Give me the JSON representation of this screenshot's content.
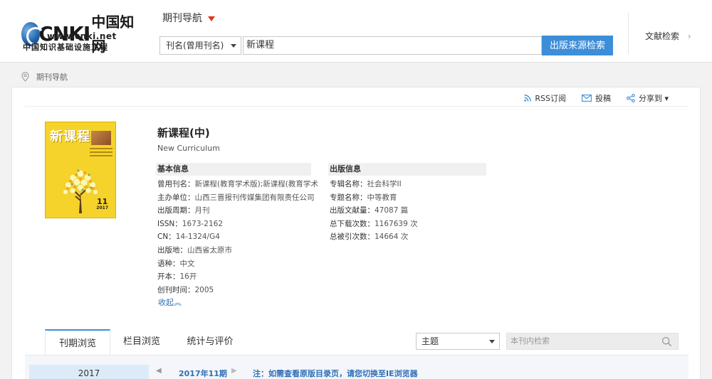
{
  "header": {
    "logo_brand": "CNKI",
    "logo_cn": "中国知网",
    "logo_url": "www.cnki.net",
    "logo_subtitle": "中国知识基础设施工程",
    "nav_title": "期刊导航",
    "search_field": "刊名(曾用刊名)",
    "search_value": "新课程",
    "search_button": "出版来源检索",
    "doc_search": "文献检索",
    "doc_search_chevron": "›"
  },
  "breadcrumb": {
    "label": "期刊导航"
  },
  "tools": {
    "rss": "RSS订阅",
    "submit": "投稿",
    "share": "分享到 ▾"
  },
  "cover": {
    "title": "新课程",
    "issue": "11",
    "year": "2017"
  },
  "journal": {
    "title": "新课程(中)",
    "title_en": "New Curriculum",
    "basic_header": "基本信息",
    "basic_info": [
      {
        "label": "曾用刊名：",
        "value": "新课程(教育学术版);新课程(教育学术)..."
      },
      {
        "label": "主办单位：",
        "value": "山西三晋报刊传媒集团有限责任公司"
      },
      {
        "label": "出版周期：",
        "value": "月刊"
      },
      {
        "label": "ISSN：",
        "value": "1673-2162"
      },
      {
        "label": "CN：",
        "value": "14-1324/G4"
      },
      {
        "label": "出版地：",
        "value": "山西省太原市"
      },
      {
        "label": "语种：",
        "value": "中文"
      },
      {
        "label": "开本：",
        "value": "16开"
      },
      {
        "label": "创刊时间：",
        "value": "2005"
      }
    ],
    "pub_header": "出版信息",
    "pub_info": [
      {
        "label": "专辑名称：",
        "value": "社会科学II"
      },
      {
        "label": "专题名称：",
        "value": "中等教育"
      },
      {
        "label": "出版文献量：",
        "value": "47087 篇"
      },
      {
        "label": "总下载次数：",
        "value": "1167639 次"
      },
      {
        "label": "总被引次数：",
        "value": "14664 次"
      }
    ],
    "collapse": "收起︽"
  },
  "tabs": {
    "issue_browse": "刊期浏览",
    "column_browse": "栏目浏览",
    "stats": "统计与评价"
  },
  "filter": {
    "topic": "主题",
    "in_search_placeholder": "本刊内检索"
  },
  "issues": {
    "year": "2017",
    "prev": "◀",
    "current": "2017年11期",
    "next": "▶",
    "note": "注：如需查看原版目录页，请您切换至IE浏览器"
  },
  "colors": {
    "accent_blue": "#3c8ed9",
    "link_blue": "#2f6fb8",
    "caret_red": "#e2321e",
    "cover_yellow": "#f6d32b"
  }
}
